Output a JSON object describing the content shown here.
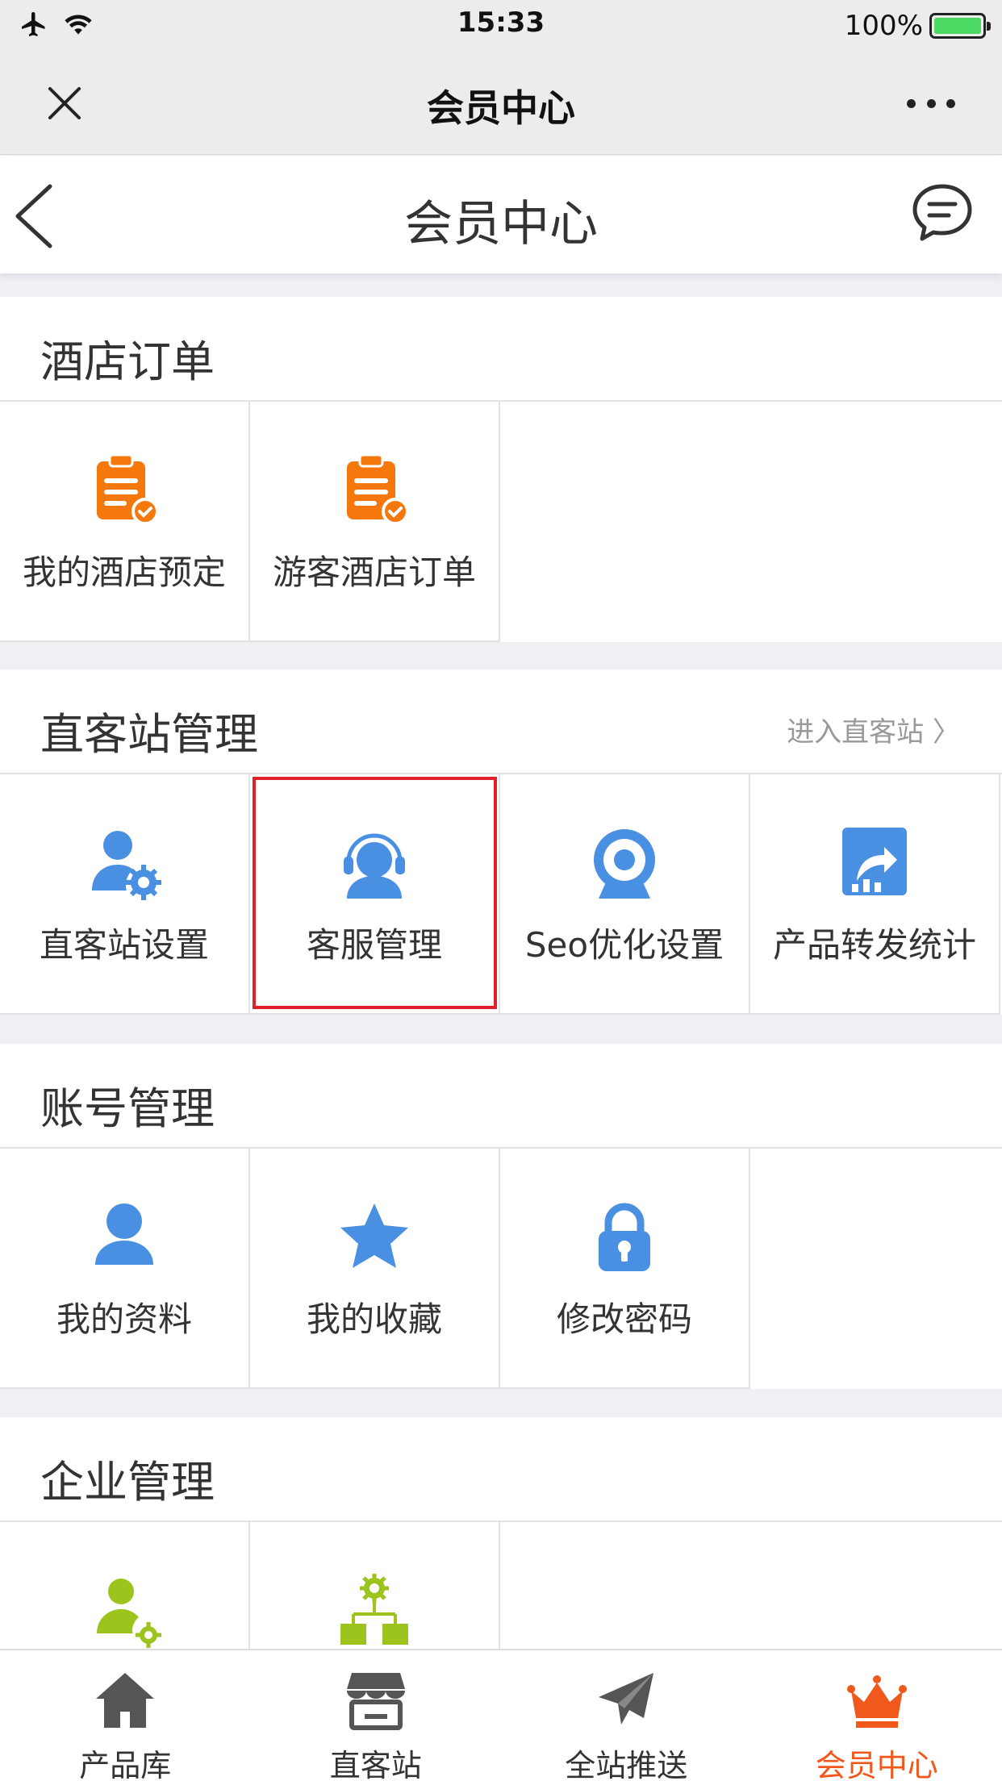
{
  "status_bar": {
    "time": "15:33",
    "battery": "100%"
  },
  "wechat_bar": {
    "title": "会员中心"
  },
  "page_header": {
    "title": "会员中心"
  },
  "sections": [
    {
      "title": "酒店订单",
      "link": "",
      "items": [
        {
          "label": "我的酒店预定",
          "icon": "clipboard-check-icon"
        },
        {
          "label": "游客酒店订单",
          "icon": "clipboard-check-icon"
        }
      ]
    },
    {
      "title": "直客站管理",
      "link": "进入直客站 〉",
      "items": [
        {
          "label": "直客站设置",
          "icon": "user-gear-icon"
        },
        {
          "label": "客服管理",
          "icon": "headset-user-icon"
        },
        {
          "label": "Seo优化设置",
          "icon": "target-icon"
        },
        {
          "label": "产品转发统计",
          "icon": "share-chart-icon"
        }
      ]
    },
    {
      "title": "账号管理",
      "link": "",
      "items": [
        {
          "label": "我的资料",
          "icon": "user-icon"
        },
        {
          "label": "我的收藏",
          "icon": "star-icon"
        },
        {
          "label": "修改密码",
          "icon": "lock-icon"
        }
      ]
    },
    {
      "title": "企业管理",
      "link": "",
      "items": [
        {
          "label": "",
          "icon": "people-gear-icon"
        },
        {
          "label": "",
          "icon": "org-chart-gear-icon"
        }
      ]
    }
  ],
  "tabbar": [
    {
      "label": "产品库",
      "icon": "home-icon"
    },
    {
      "label": "直客站",
      "icon": "store-icon"
    },
    {
      "label": "全站推送",
      "icon": "paper-plane-icon"
    },
    {
      "label": "会员中心",
      "icon": "crown-icon",
      "active": true
    }
  ],
  "colors": {
    "orange": "#f5780d",
    "blue": "#4a90e2",
    "green": "#9dc41d",
    "active_tab": "#f0581c",
    "highlight": "#e0202a"
  }
}
